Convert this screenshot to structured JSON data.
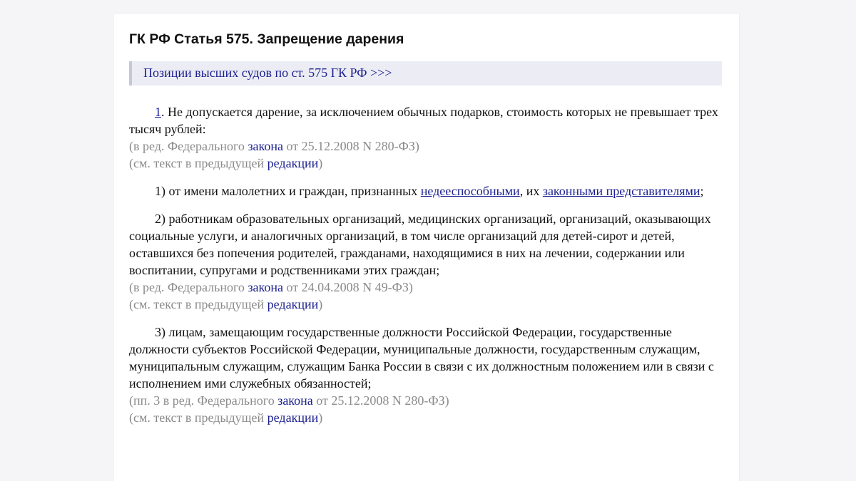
{
  "title": "ГК РФ Статья 575. Запрещение дарения",
  "court_link": "Позиции высших судов по ст. 575 ГК РФ >>>",
  "p1": {
    "num": "1",
    "text": ". Не допускается дарение, за исключением обычных подарков, стоимость которых не превышает трех тысяч рублей:",
    "note1": {
      "before": "(в ред. Федерального ",
      "link": "закона",
      "after": " от 25.12.2008 N 280-ФЗ)"
    },
    "note2": {
      "before": "(см. текст в предыдущей ",
      "link": "редакции",
      "after": ")"
    }
  },
  "item1": {
    "part1": "1) от имени малолетних и граждан, признанных ",
    "link1": "недееспособными",
    "part2": ", их ",
    "link2": "законными представителями",
    "part3": ";"
  },
  "item2": {
    "text": "2) работникам образовательных организаций, медицинских организаций, организаций, оказывающих социальные услуги, и аналогичных организаций, в том числе организаций для детей-сирот и детей, оставшихся без попечения родителей, гражданами, находящимися в них на лечении, содержании или воспитании, супругами и родственниками этих граждан;",
    "note1": {
      "before": "(в ред. Федерального ",
      "link": "закона",
      "after": " от 24.04.2008 N 49-ФЗ)"
    },
    "note2": {
      "before": "(см. текст в предыдущей ",
      "link": "редакции",
      "after": ")"
    }
  },
  "item3": {
    "text": "3) лицам, замещающим государственные должности Российской Федерации, государственные должности субъектов Российской Федерации, муниципальные должности, государственным служащим, муниципальным служащим, служащим Банка России в связи с их должностным положением или в связи с исполнением ими служебных обязанностей;",
    "note1": {
      "before": "(пп. 3 в ред. Федерального ",
      "link": "закона",
      "after": " от 25.12.2008 N 280-ФЗ)"
    },
    "note2": {
      "before": "(см. текст в предыдущей ",
      "link": "редакции",
      "after": ")"
    }
  }
}
